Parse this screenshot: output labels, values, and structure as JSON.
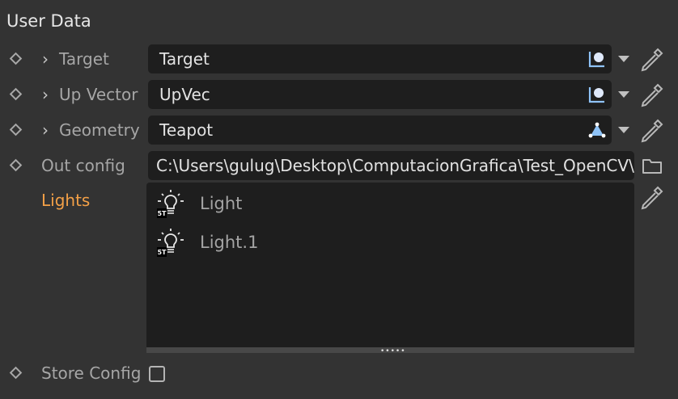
{
  "panel": {
    "title": "User Data"
  },
  "rows": {
    "target": {
      "label": "Target",
      "value": "Target",
      "icon": "null-object-icon"
    },
    "up_vector": {
      "label": "Up Vector",
      "value": "UpVec",
      "icon": "null-object-icon"
    },
    "geometry": {
      "label": "Geometry",
      "value": "Teapot",
      "icon": "polygon-object-icon"
    },
    "out_config": {
      "label": "Out config",
      "value": "C:\\Users\\gulug\\Desktop\\ComputacionGrafica\\Test_OpenCV\\"
    },
    "lights": {
      "label": "Lights",
      "items": [
        "Light",
        "Light.1"
      ],
      "item_icon": "light-bulb-icon",
      "item_badge": "5T"
    },
    "store_config": {
      "label": "Store Config",
      "checked": false
    }
  },
  "colors": {
    "background": "#333333",
    "field": "#1e1e1e",
    "accent_label": "#f3a047",
    "icon_blue": "#8fc3f7"
  }
}
